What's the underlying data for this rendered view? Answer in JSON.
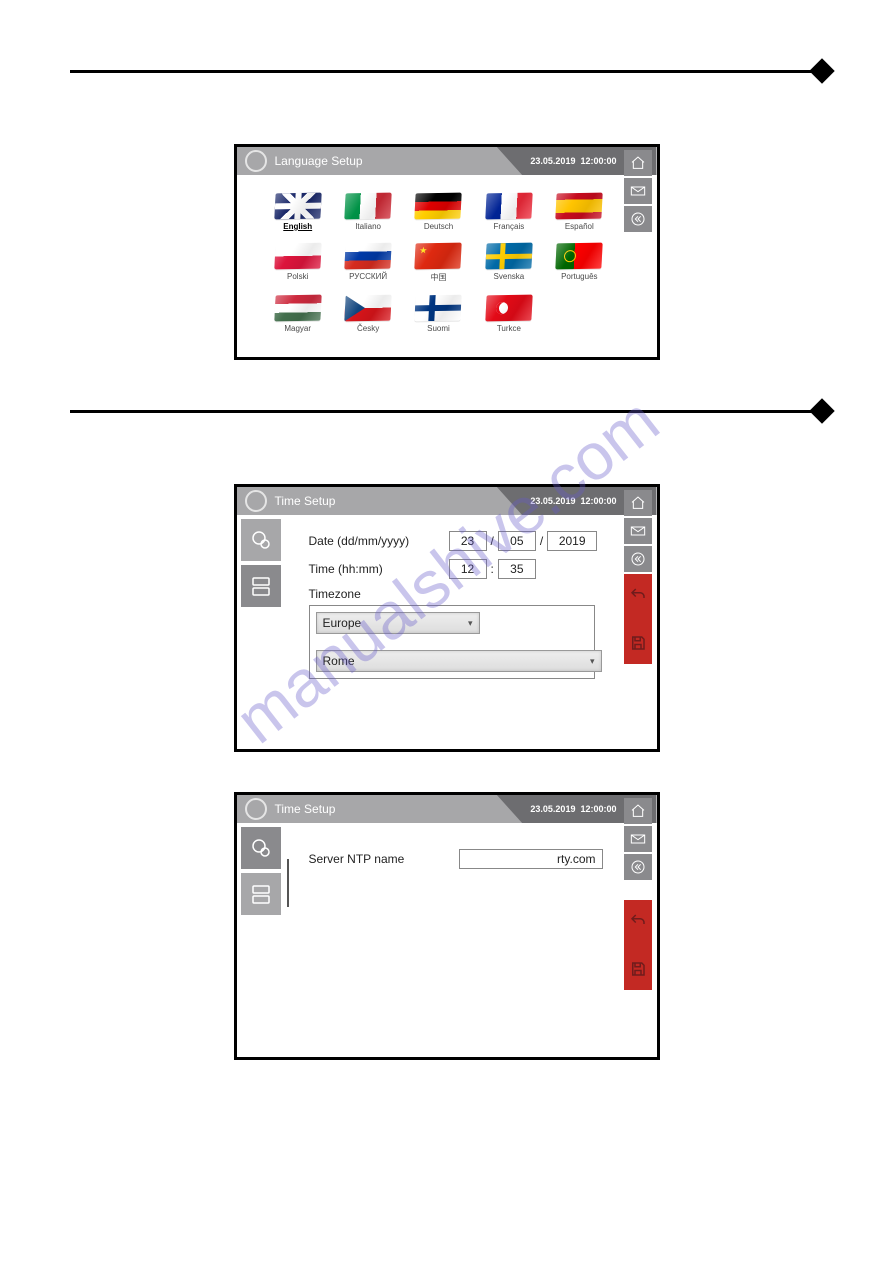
{
  "watermark": "manualshive.com",
  "sections": [
    {
      "title": "Language Setup",
      "date": "23.05.2019",
      "time": "12:00:00"
    },
    {
      "title": "Time Setup",
      "date": "23.05.2019",
      "time": "12:00:00"
    },
    {
      "title": "Time Setup",
      "date": "23.05.2019",
      "time": "12:00:00"
    }
  ],
  "languages": [
    {
      "label": "English",
      "flag": "uk",
      "selected": true
    },
    {
      "label": "Italiano",
      "flag": "it"
    },
    {
      "label": "Deutsch",
      "flag": "de"
    },
    {
      "label": "Français",
      "flag": "fr"
    },
    {
      "label": "Español",
      "flag": "es"
    },
    {
      "label": "Polski",
      "flag": "pl"
    },
    {
      "label": "РУССКИЙ",
      "flag": "ru"
    },
    {
      "label": "中国",
      "flag": "cn"
    },
    {
      "label": "Svenska",
      "flag": "se"
    },
    {
      "label": "Português",
      "flag": "pt"
    },
    {
      "label": "Magyar",
      "flag": "hu"
    },
    {
      "label": "Česky",
      "flag": "cz"
    },
    {
      "label": "Suomi",
      "flag": "fi"
    },
    {
      "label": "Turkce",
      "flag": "tr"
    }
  ],
  "timeSetup": {
    "dateLabel": "Date (dd/mm/yyyy)",
    "day": "23",
    "month": "05",
    "year": "2019",
    "timeLabel": "Time (hh:mm)",
    "hour": "12",
    "minute": "35",
    "tzLabel": "Timezone",
    "tzRegion": "Europe",
    "tzCity": "Rome"
  },
  "ntp": {
    "label": "Server NTP name",
    "value": "rty.com"
  }
}
